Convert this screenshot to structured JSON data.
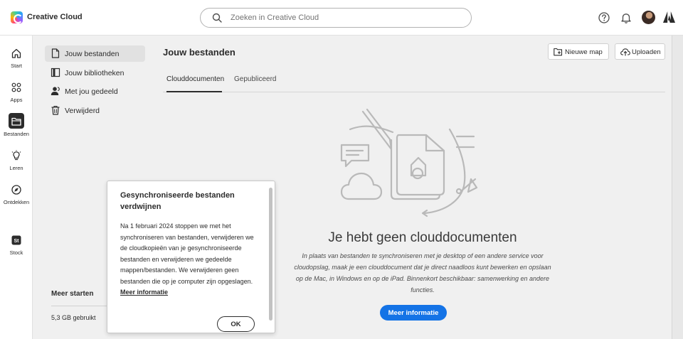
{
  "app": {
    "title": "Creative Cloud"
  },
  "search": {
    "placeholder": "Zoeken in Creative Cloud"
  },
  "rail": {
    "items": [
      {
        "label": "Start",
        "icon": "home-icon"
      },
      {
        "label": "Apps",
        "icon": "apps-icon"
      },
      {
        "label": "Bestanden",
        "icon": "folder-icon",
        "active": true
      },
      {
        "label": "Leren",
        "icon": "lightbulb-icon"
      },
      {
        "label": "Ontdekken",
        "icon": "compass-icon"
      },
      {
        "label": "Stock",
        "icon": "stock-icon"
      }
    ]
  },
  "sidebar": {
    "items": [
      {
        "label": "Jouw bestanden",
        "icon": "file-icon",
        "active": true
      },
      {
        "label": "Jouw bibliotheken",
        "icon": "libraries-icon"
      },
      {
        "label": "Met jou gedeeld",
        "icon": "shared-users-icon"
      },
      {
        "label": "Verwijderd",
        "icon": "trash-icon"
      }
    ],
    "storage": {
      "title": "Meer starten",
      "used": "5,3 GB gebruikt"
    }
  },
  "main": {
    "title": "Jouw bestanden",
    "new_folder_label": "Nieuwe map",
    "upload_label": "Uploaden",
    "tabs": [
      {
        "label": "Clouddocumenten",
        "active": true
      },
      {
        "label": "Gepubliceerd"
      }
    ],
    "empty": {
      "title": "Je hebt geen clouddocumenten",
      "description": "In plaats van bestanden te synchroniseren met je desktop of een andere service voor cloudopslag, maak je een clouddocument dat je direct naadloos kunt bewerken en opslaan op de Mac, in Windows en op de iPad. Binnenkort beschikbaar: samenwerking en andere functies.",
      "button_label": "Meer informatie"
    }
  },
  "popover": {
    "title": "Gesynchroniseerde bestanden verdwijnen",
    "body": "Na 1 februari 2024 stoppen we met het synchroniseren van bestanden, verwijderen we de cloudkopieën van je gesynchroniseerde bestanden en verwijderen we gedeelde mappen/bestanden. We verwijderen geen bestanden die op je computer zijn opgeslagen.",
    "link": "Meer informatie",
    "ok_label": "OK"
  },
  "colors": {
    "accent": "#1473e6",
    "background": "#f0f0f0",
    "text": "#2c2c2c"
  }
}
